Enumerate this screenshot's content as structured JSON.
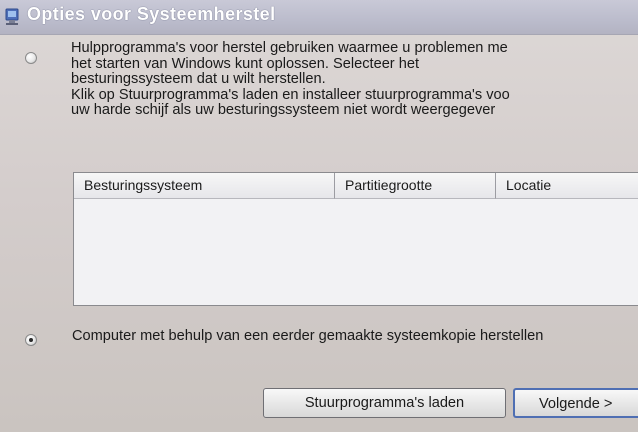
{
  "window": {
    "title": "Opties voor Systeemherstel"
  },
  "option_repair": {
    "selected": false,
    "lines": [
      "Hulpprogramma's voor herstel gebruiken waarmee u problemen me",
      "het starten van Windows kunt oplossen. Selecteer het",
      "besturingssysteem dat u wilt herstellen.",
      "Klik op Stuurprogramma's laden en installeer stuurprogramma's voo",
      "uw harde schijf als uw besturingssysteem niet wordt weergegever"
    ]
  },
  "os_table": {
    "columns": [
      "Besturingssysteem",
      "Partitiegrootte",
      "Locatie"
    ],
    "rows": []
  },
  "option_restore": {
    "selected": true,
    "label": "Computer met behulp van een eerder gemaakte systeemkopie herstellen"
  },
  "buttons": {
    "load_drivers": "Stuurprogramma's laden",
    "next": "Volgende >"
  }
}
